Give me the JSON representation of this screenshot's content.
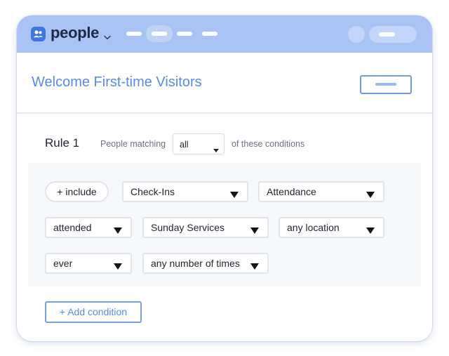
{
  "app": {
    "name": "people",
    "logo_icon": "people-logo-icon",
    "switcher_icon": "chevron-down-icon"
  },
  "colors": {
    "topbar": "#a9c3f4",
    "accent": "#5a8be4",
    "logo": "#3d78de"
  },
  "page": {
    "title": "Welcome First-time Visitors"
  },
  "rule": {
    "label": "Rule 1",
    "matching_prefix": "People matching",
    "matching_value": "all",
    "matching_suffix": "of these conditions"
  },
  "conditions": {
    "include_label": "+ include",
    "row1": {
      "source": "Check-Ins",
      "metric": "Attendance"
    },
    "row2": {
      "status": "attended",
      "event": "Sunday Services",
      "location": "any location"
    },
    "row3": {
      "period": "ever",
      "frequency": "any number of times"
    },
    "dropdown_icon": "caret-down-icon"
  },
  "actions": {
    "add_condition": "+ Add condition"
  }
}
